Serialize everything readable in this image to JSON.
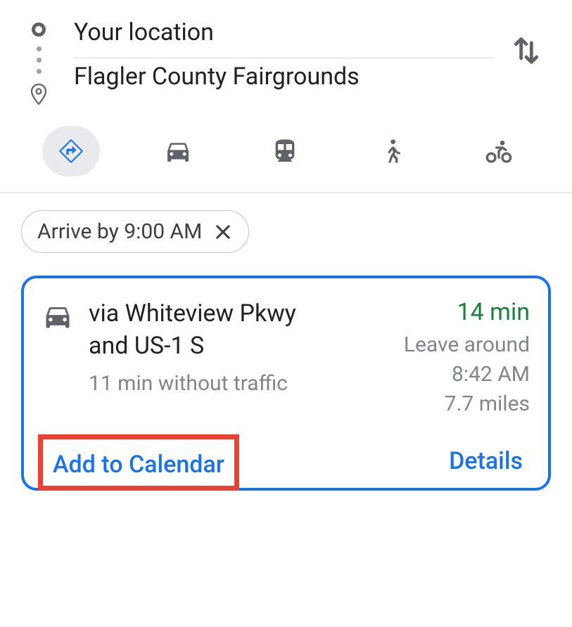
{
  "origin": {
    "value": "Your location"
  },
  "destination": {
    "value": "Flagler County Fairgrounds"
  },
  "modes": {
    "best": "directions",
    "car": "car",
    "transit": "transit",
    "walk": "walk",
    "bike": "bike"
  },
  "time_chip": {
    "label": "Arrive by 9:00 AM"
  },
  "route": {
    "via": "via Whiteview Pkwy and US-1 S",
    "without_traffic": "11 min without traffic",
    "duration": "14 min",
    "leave_text": "Leave around 8:42 AM",
    "distance": "7.7 miles"
  },
  "actions": {
    "add_calendar": "Add to Calendar",
    "details": "Details"
  }
}
